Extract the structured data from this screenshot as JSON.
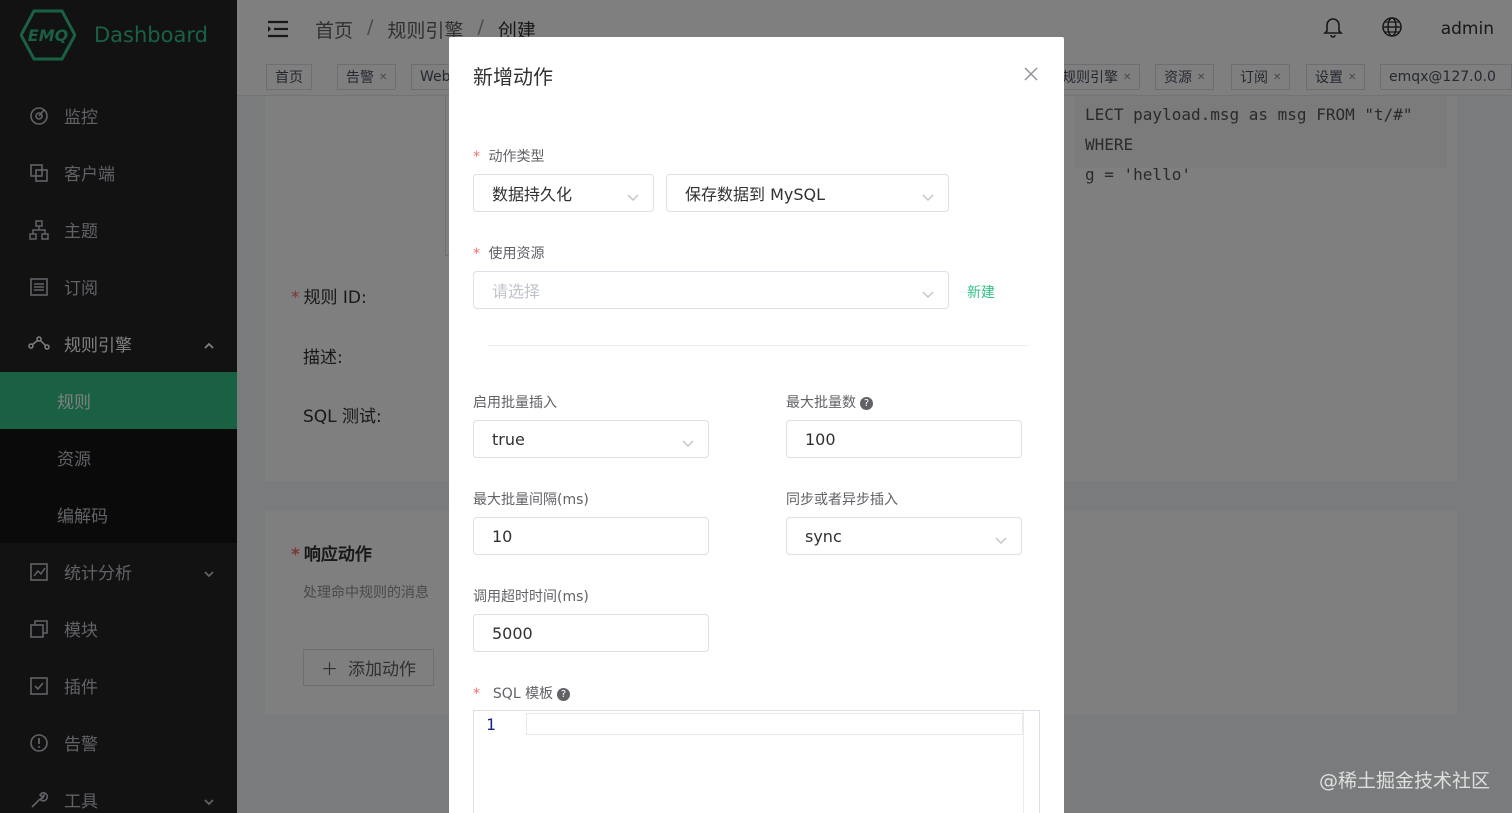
{
  "app": {
    "logo_mark": "EMQ",
    "title": "Dashboard",
    "accent_color": "#34c388",
    "sidebar_bg": "#242427"
  },
  "sidebar": {
    "items": [
      {
        "label": "监控",
        "icon": "monitor-icon"
      },
      {
        "label": "客户端",
        "icon": "clients-icon"
      },
      {
        "label": "主题",
        "icon": "topics-icon"
      },
      {
        "label": "订阅",
        "icon": "subscriptions-icon"
      },
      {
        "label": "规则引擎",
        "icon": "rule-engine-icon"
      },
      {
        "label": "统计分析",
        "icon": "analytics-icon"
      },
      {
        "label": "模块",
        "icon": "modules-icon"
      },
      {
        "label": "插件",
        "icon": "plugins-icon"
      },
      {
        "label": "告警",
        "icon": "alarm-icon"
      },
      {
        "label": "工具",
        "icon": "tools-icon"
      }
    ],
    "submenu": [
      {
        "label": "规则",
        "active": true
      },
      {
        "label": "资源",
        "active": false
      },
      {
        "label": "编解码",
        "active": false
      }
    ]
  },
  "header": {
    "breadcrumb": [
      "首页",
      "/",
      "规则引擎",
      "/",
      "创建"
    ],
    "user": "admin"
  },
  "tags": [
    "首页",
    "告警",
    "Web",
    "规则引擎",
    "资源",
    "订阅",
    "设置",
    "emqx@127.0.0"
  ],
  "background_form": {
    "sql_line1": "LECT payload.msg as msg FROM \"t/#\" WHERE",
    "sql_line2": "g = 'hello'",
    "rule_id_label": "规则 ID:",
    "desc_label": "描述:",
    "sql_test_label": "SQL 测试:",
    "actions_title": "响应动作",
    "actions_desc": "处理命中规则的消息",
    "add_action": "添加动作"
  },
  "dialog": {
    "title": "新增动作",
    "action_type_label": "动作类型",
    "action_category": "数据持久化",
    "action_name": "保存数据到 MySQL",
    "resource_label": "使用资源",
    "resource_placeholder": "请选择",
    "new_resource": "新建",
    "batch_insert_label": "启用批量插入",
    "batch_insert_value": "true",
    "batch_size_label": "最大批量数",
    "batch_size_value": "100",
    "batch_interval_label": "最大批量间隔(ms)",
    "batch_interval_value": "10",
    "sync_mode_label": "同步或者异步插入",
    "sync_mode_value": "sync",
    "timeout_label": "调用超时时间(ms)",
    "timeout_value": "5000",
    "sql_template_label": "SQL 模板",
    "editor_line_number": "1"
  },
  "watermark": "@稀土掘金技术社区"
}
